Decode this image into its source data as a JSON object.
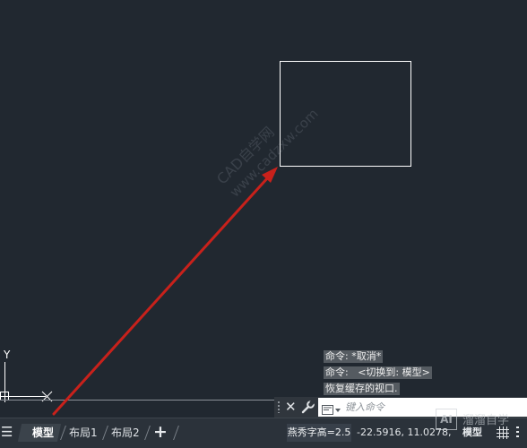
{
  "canvas": {
    "background": "#212830",
    "watermark": {
      "line1": "CAD自学网",
      "line2": "www.cadzxw.com"
    },
    "ucs": {
      "y_label": "Y"
    },
    "arrow_color": "#c8211b"
  },
  "command_history": {
    "lines": [
      "命令: *取消*",
      "命令:   <切换到: 模型>",
      "恢复缓存的视口."
    ]
  },
  "command_line": {
    "close_glyph": "✕",
    "input_placeholder": "键入命令",
    "input_value": ""
  },
  "statusbar": {
    "menu_glyph": "☰",
    "tabs": [
      {
        "label": "模型",
        "active": true
      },
      {
        "label": "布局1",
        "active": false
      },
      {
        "label": "布局2",
        "active": false
      }
    ],
    "add_tab_glyph": "+",
    "font_height": "燕秀字高=2.5",
    "coordinates": "-22.5916, 11.0278,",
    "model_status": "模型",
    "grid_icon": "grid-icon"
  },
  "overlay_logo": {
    "mark": "AI",
    "text": "溜溜自学"
  }
}
